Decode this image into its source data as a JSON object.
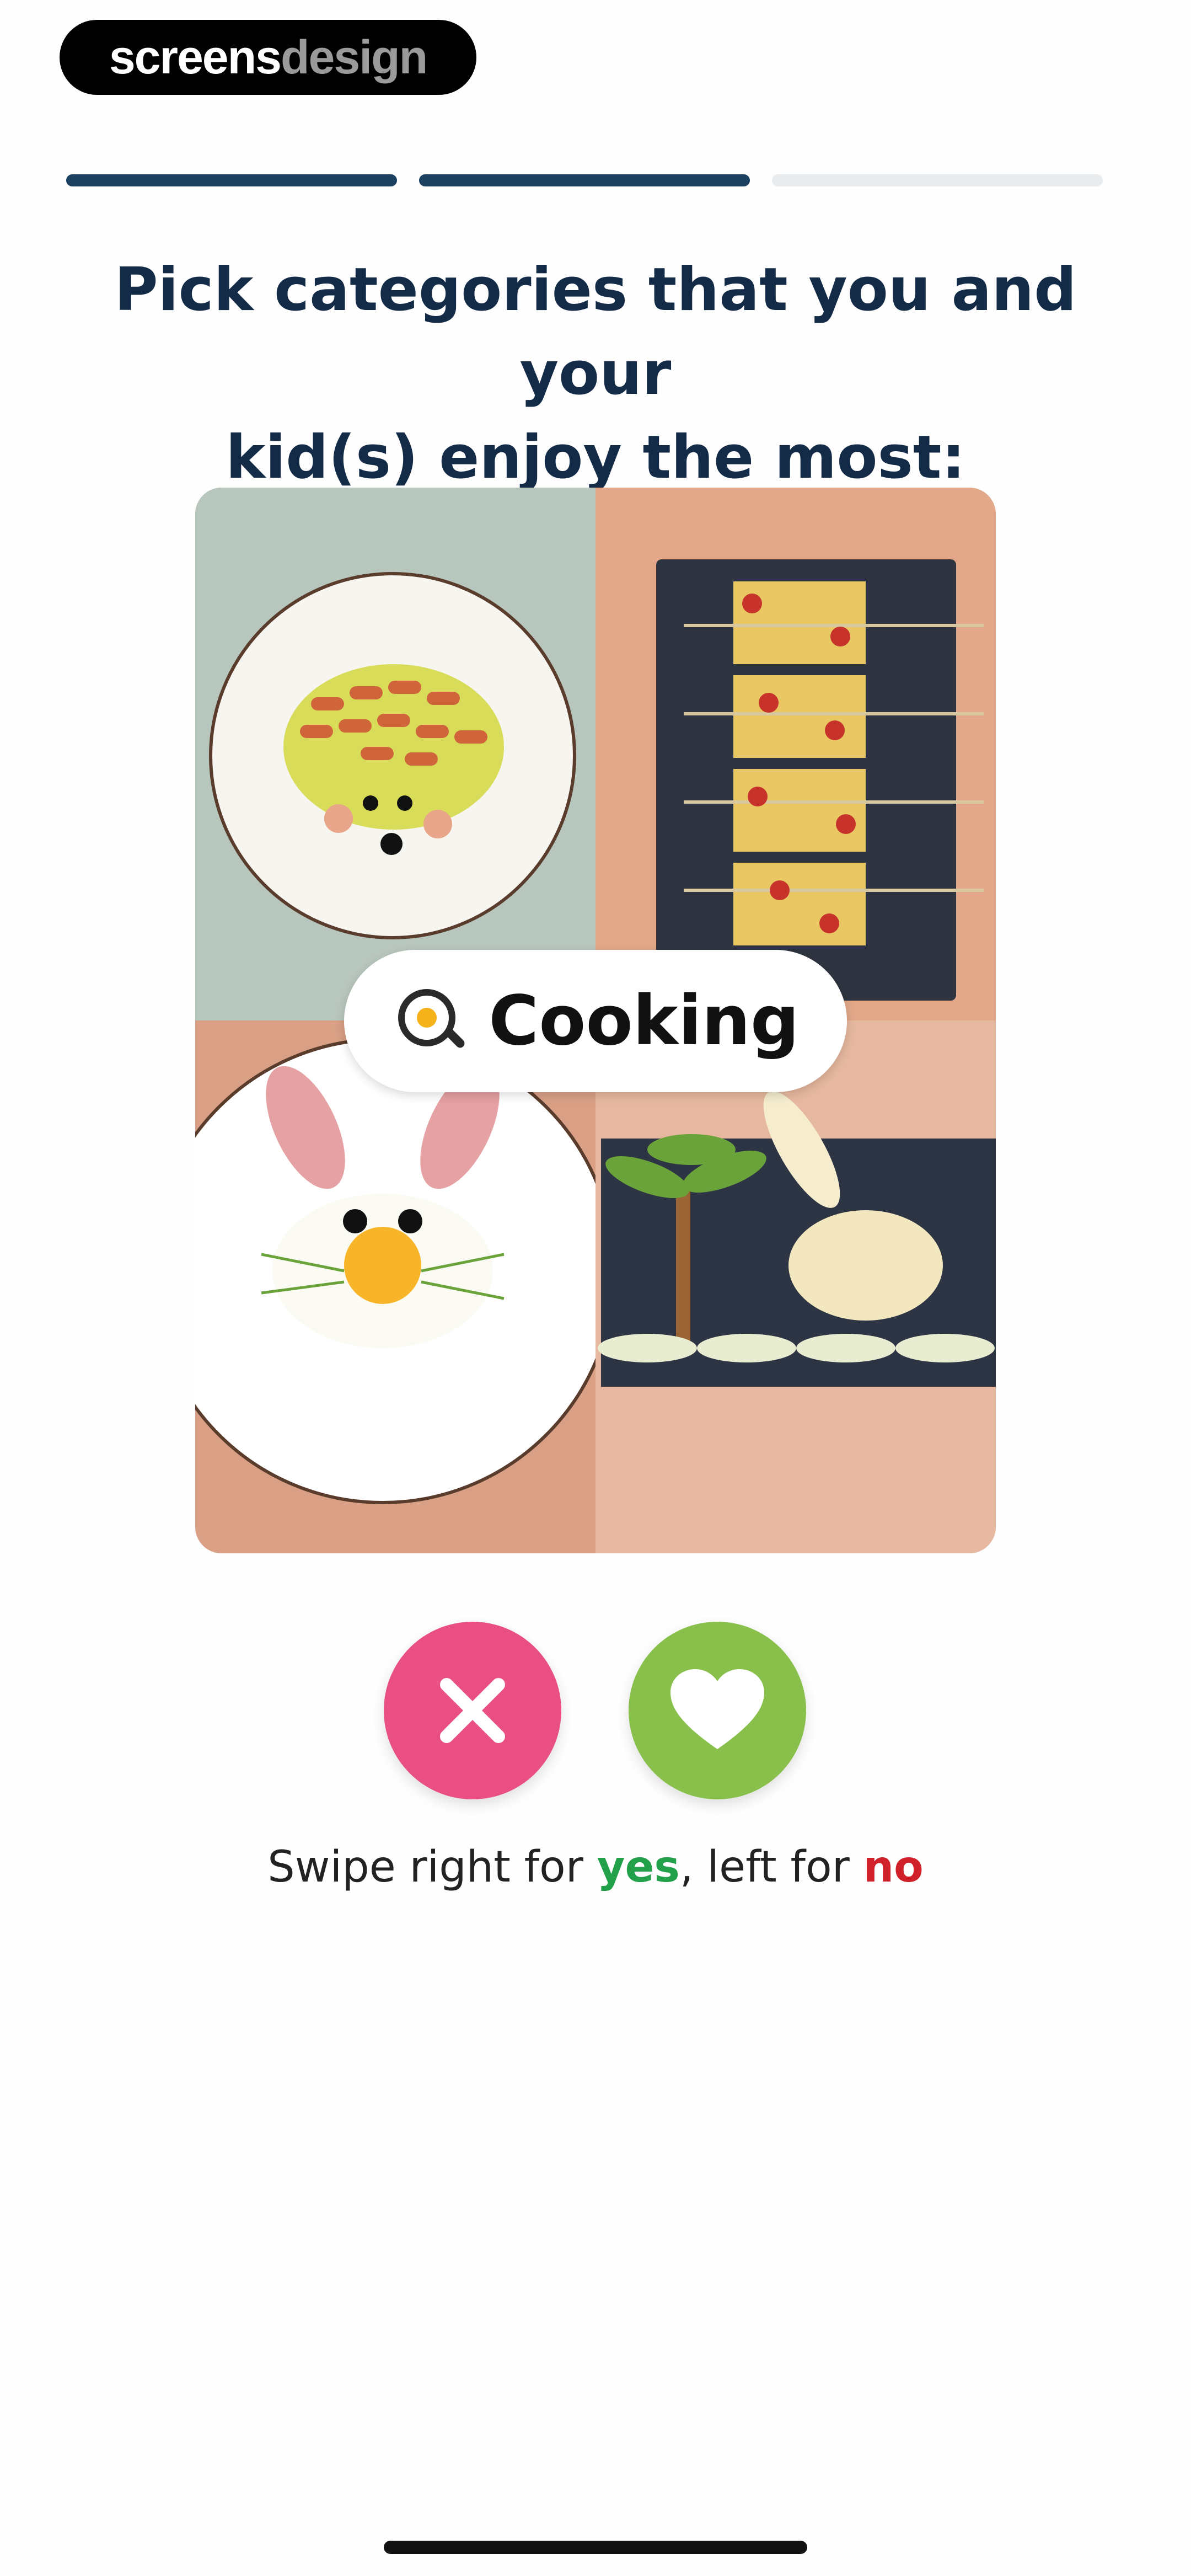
{
  "logo": {
    "part1": "screens",
    "part2": "design"
  },
  "progress": {
    "steps_total": 3,
    "steps_completed": 2
  },
  "title": {
    "line1": "Pick categories that you and your",
    "line2": "kid(s) enjoy the most:"
  },
  "card": {
    "category_label": "Cooking",
    "category_icon": "frying-pan-egg-icon"
  },
  "actions": {
    "dislike_icon": "close-icon",
    "like_icon": "heart-icon",
    "dislike_color": "#e94f83",
    "like_color": "#89c04b"
  },
  "hint": {
    "prefix": "Swipe right for ",
    "yes": "yes",
    "middle": ", left for ",
    "no": "no"
  },
  "colors": {
    "title": "#142b48",
    "progress_active": "#1b4060",
    "progress_inactive": "#e9ecef"
  }
}
